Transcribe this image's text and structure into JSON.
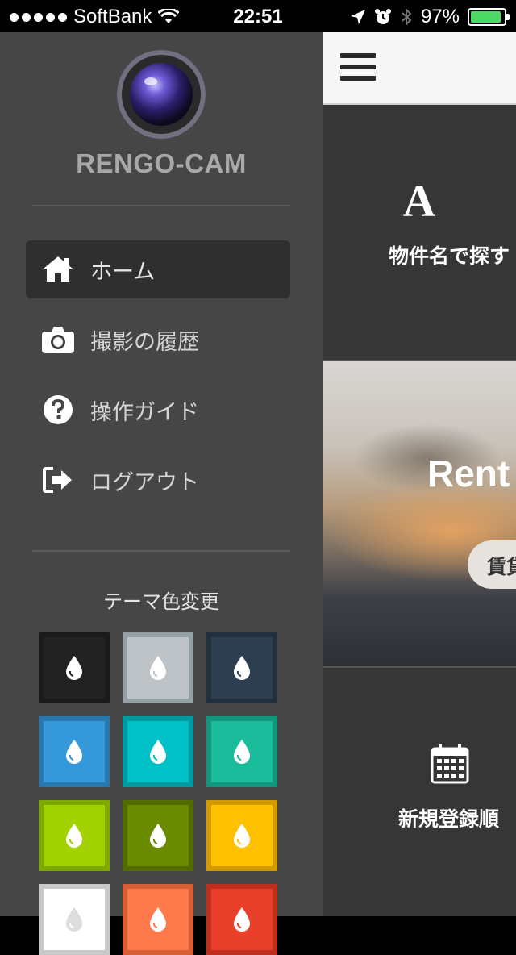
{
  "status_bar": {
    "carrier": "SoftBank",
    "time": "22:51",
    "battery_text": "97%",
    "battery_level": 0.97,
    "battery_color": "#4cd964"
  },
  "sidebar": {
    "brand": "RENGO-CAM",
    "menu": [
      {
        "label": "ホーム",
        "icon": "home-icon",
        "active": true
      },
      {
        "label": "撮影の履歴",
        "icon": "camera-icon",
        "active": false
      },
      {
        "label": "操作ガイド",
        "icon": "help-icon",
        "active": false
      },
      {
        "label": "ログアウト",
        "icon": "logout-icon",
        "active": false
      }
    ],
    "theme_title": "テーマ色変更",
    "swatches": [
      {
        "fill": "#222222",
        "border": "#1a1a1a"
      },
      {
        "fill": "#bdc3c7",
        "border": "#95a0a5"
      },
      {
        "fill": "#2c3e50",
        "border": "#22303e"
      },
      {
        "fill": "#3498db",
        "border": "#2878ae"
      },
      {
        "fill": "#00c0c8",
        "border": "#009aa0"
      },
      {
        "fill": "#1abc9c",
        "border": "#14967c"
      },
      {
        "fill": "#a2d200",
        "border": "#7fa800"
      },
      {
        "fill": "#6a8a00",
        "border": "#536c00"
      },
      {
        "fill": "#ffc000",
        "border": "#d19b00"
      },
      {
        "fill": "#ffffff",
        "border": "#c8c8c8"
      },
      {
        "fill": "#ff7a4a",
        "border": "#d65f35"
      },
      {
        "fill": "#e8402a",
        "border": "#bf2f1e"
      }
    ]
  },
  "content": {
    "search_icon_text": "A",
    "search_by_name": "物件名で探す",
    "hero_title": "Rent",
    "hero_button": "賃貸",
    "new_order": "新規登録順"
  }
}
